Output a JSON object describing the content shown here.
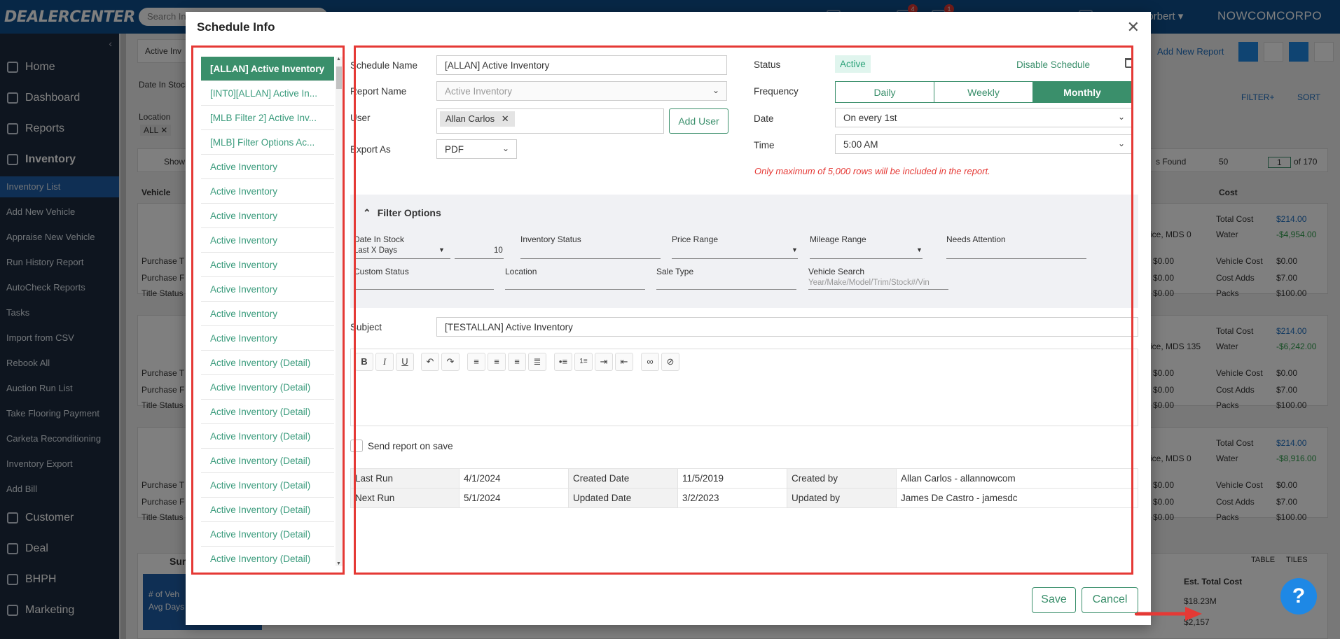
{
  "app": {
    "logo": "DEALERCENTER",
    "search_placeholder": "Search In",
    "user": "norbert",
    "company": "NOWCOMCORPO",
    "badges": [
      "4",
      "1"
    ]
  },
  "sidebar": {
    "sections": [
      {
        "label": "Home",
        "icon": "home-icon"
      },
      {
        "label": "Dashboard",
        "icon": "dashboard-icon"
      },
      {
        "label": "Reports",
        "icon": "reports-icon"
      },
      {
        "label": "Inventory",
        "icon": "car-icon"
      }
    ],
    "inventory_items": [
      "Inventory List",
      "Add New Vehicle",
      "Appraise New Vehicle",
      "Run History Report",
      "AutoCheck Reports",
      "Tasks",
      "Import from CSV",
      "Rebook All",
      "Auction Run List",
      "Take Flooring Payment",
      "Carketa Reconditioning",
      "Inventory Export",
      "Add Bill"
    ],
    "lower_sections": [
      {
        "label": "Customer",
        "icon": "customer-icon"
      },
      {
        "label": "Deal",
        "icon": "deal-icon"
      },
      {
        "label": "BHPH",
        "icon": "bhph-icon"
      },
      {
        "label": "Marketing",
        "icon": "tag-icon"
      }
    ]
  },
  "background": {
    "tab": "Active Inv",
    "add_new_report": "Add New Report",
    "date_in_stock": "Date In Stock",
    "location_label": "Location",
    "location_chip": "ALL",
    "show_label": "Show",
    "vehicle_col": "Vehicle",
    "cost_col": "Cost",
    "filter_plus": "FILTER+",
    "sort": "SORT",
    "found": "s Found",
    "per_page": "50",
    "page": "1",
    "of_pages": "of 170",
    "summary": "Sur",
    "table_tab": "TABLE",
    "tiles_tab": "TILES",
    "est_total_cost": "Est. Total Cost",
    "est_values": [
      "$18.23M",
      "$2,157"
    ],
    "vehicles_label": "# of Veh",
    "avg_days": "Avg Days",
    "row_labels": [
      "Purchase T",
      "Purchase F",
      "Title Status"
    ],
    "cards": [
      {
        "mds": "ice, MDS 0",
        "total_cost": "$214.00",
        "water": "-$4,954.00",
        "v1": "$0.00",
        "v2": "$0.00",
        "v3": "$0.00",
        "vehicle_cost": "$0.00",
        "cost_adds": "$7.00",
        "packs": "$100.00"
      },
      {
        "mds": "ice, MDS 135",
        "total_cost": "$214.00",
        "water": "-$6,242.00",
        "v1": "$0.00",
        "v2": "$0.00",
        "v3": "$0.00",
        "vehicle_cost": "$0.00",
        "cost_adds": "$7.00",
        "packs": "$100.00"
      },
      {
        "mds": "ice, MDS 0",
        "total_cost": "$214.00",
        "water": "-$8,916.00",
        "v1": "$0.00",
        "v2": "$0.00",
        "v3": "$0.00",
        "vehicle_cost": "$0.00",
        "cost_adds": "$7.00",
        "packs": "$100.00"
      }
    ],
    "cost_labels": {
      "total_cost": "Total Cost",
      "water": "Water",
      "vehicle_cost": "Vehicle Cost",
      "cost_adds": "Cost Adds",
      "packs": "Packs"
    }
  },
  "modal": {
    "title": "Schedule Info",
    "schedules": [
      "[ALLAN] Active Inventory",
      "[INT0][ALLAN] Active In...",
      "[MLB Filter 2] Active Inv...",
      "[MLB] Filter Options Ac...",
      "Active Inventory",
      "Active Inventory",
      "Active Inventory",
      "Active Inventory",
      "Active Inventory",
      "Active Inventory",
      "Active Inventory",
      "Active Inventory",
      "Active Inventory (Detail)",
      "Active Inventory (Detail)",
      "Active Inventory (Detail)",
      "Active Inventory (Detail)",
      "Active Inventory (Detail)",
      "Active Inventory (Detail)",
      "Active Inventory (Detail)",
      "Active Inventory (Detail)",
      "Active Inventory (Detail)"
    ],
    "form": {
      "schedule_name_label": "Schedule Name",
      "schedule_name": "[ALLAN] Active Inventory",
      "report_name_label": "Report Name",
      "report_name": "Active Inventory",
      "user_label": "User",
      "user_chip": "Allan Carlos",
      "add_user": "Add User",
      "export_label": "Export As",
      "export_value": "PDF",
      "status_label": "Status",
      "status_value": "Active",
      "disable_schedule": "Disable Schedule",
      "frequency_label": "Frequency",
      "frequency_options": [
        "Daily",
        "Weekly",
        "Monthly"
      ],
      "frequency_selected": "Monthly",
      "date_label": "Date",
      "date_value": "On every 1st",
      "time_label": "Time",
      "time_value": "5:00 AM",
      "max_rows_warning": "Only maximum of 5,000 rows will be included in the report."
    },
    "filters": {
      "header": "Filter Options",
      "date_in_stock_label": "Date In Stock",
      "date_in_stock_mode": "Last X Days",
      "date_in_stock_days": "10",
      "inventory_status_label": "Inventory Status",
      "price_range_label": "Price Range",
      "mileage_range_label": "Mileage Range",
      "needs_attention_label": "Needs Attention",
      "custom_status_label": "Custom Status",
      "location_label": "Location",
      "sale_type_label": "Sale Type",
      "vehicle_search_label": "Vehicle Search",
      "vehicle_search_placeholder": "Year/Make/Model/Trim/Stock#/Vin"
    },
    "subject_label": "Subject",
    "subject_value": "[TESTALLAN] Active Inventory",
    "toolbar_glyphs": {
      "bold": "B",
      "italic": "I",
      "underline": "U"
    },
    "send_on_save": "Send report on save",
    "info": {
      "last_run_label": "Last Run",
      "last_run": "4/1/2024",
      "created_date_label": "Created Date",
      "created_date": "11/5/2019",
      "created_by_label": "Created by",
      "created_by": "Allan Carlos - allannowcom",
      "next_run_label": "Next Run",
      "next_run": "5/1/2024",
      "updated_date_label": "Updated Date",
      "updated_date": "3/2/2023",
      "updated_by_label": "Updated by",
      "updated_by": "James De Castro - jamesdc"
    },
    "save": "Save",
    "cancel": "Cancel"
  },
  "colors": {
    "accent": "#3a8f6b",
    "highlight": "#e53935",
    "topbar": "#0e4f8c",
    "sidebar": "#1c2b3e"
  },
  "help": "?"
}
